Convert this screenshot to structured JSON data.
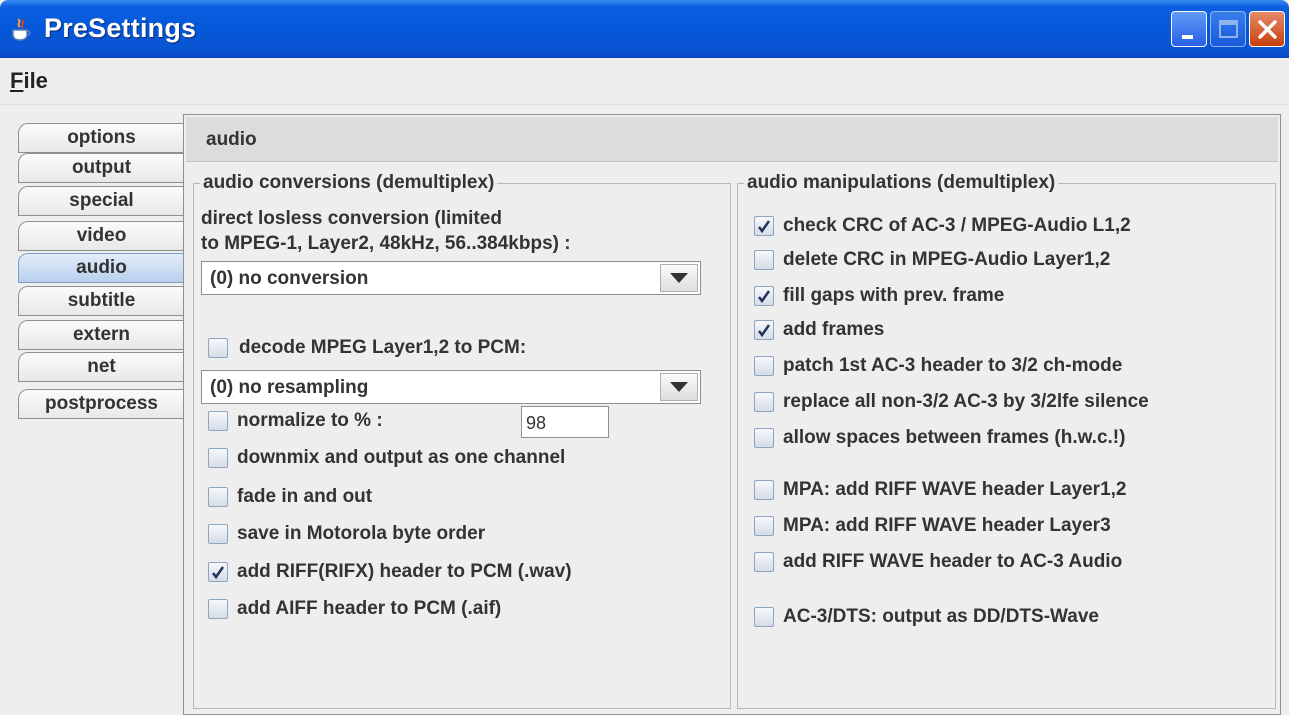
{
  "window": {
    "title": "PreSettings"
  },
  "menu": {
    "file_mnemonic": "F",
    "file_rest": "ile"
  },
  "tabs": [
    {
      "label": "options",
      "active": false
    },
    {
      "label": "output",
      "active": false
    },
    {
      "label": "special",
      "active": false
    },
    {
      "label": "video",
      "active": false
    },
    {
      "label": "audio",
      "active": true
    },
    {
      "label": "subtitle",
      "active": false
    },
    {
      "label": "extern",
      "active": false
    },
    {
      "label": "net",
      "active": false
    },
    {
      "label": "postprocess",
      "active": false
    }
  ],
  "panel": {
    "title": "audio"
  },
  "conversions": {
    "title": "audio conversions (demultiplex)",
    "desc_line1": "direct losless conversion (limited",
    "desc_line2": "to MPEG-1, Layer2, 48kHz, 56..384kbps) :",
    "conversion_combo": "(0) no conversion",
    "decode_label": "decode MPEG Layer1,2 to PCM:",
    "decode_checked": false,
    "resampling_combo": "(0) no resampling",
    "normalize_label": "normalize to % :",
    "normalize_checked": false,
    "normalize_value": "98",
    "options": [
      {
        "label": "downmix and output as one channel",
        "checked": false
      },
      {
        "label": "fade in and out",
        "checked": false
      },
      {
        "label": "save in Motorola byte order",
        "checked": false
      },
      {
        "label": "add RIFF(RIFX) header to PCM (.wav)",
        "checked": true
      },
      {
        "label": "add AIFF header to PCM (.aif)",
        "checked": false
      }
    ]
  },
  "manipulations": {
    "title": "audio manipulations (demultiplex)",
    "options": [
      {
        "label": "check CRC of AC-3 / MPEG-Audio L1,2",
        "checked": true
      },
      {
        "label": "delete CRC in MPEG-Audio Layer1,2",
        "checked": false
      },
      {
        "label": "fill gaps with prev. frame",
        "checked": true
      },
      {
        "label": "add frames",
        "checked": true
      },
      {
        "label": "patch 1st AC-3 header to 3/2 ch-mode",
        "checked": false
      },
      {
        "label": "replace all non-3/2 AC-3 by 3/2lfe silence",
        "checked": false
      },
      {
        "label": "allow spaces between frames (h.w.c.!)",
        "checked": false
      },
      {
        "label": "MPA: add RIFF WAVE header Layer1,2",
        "checked": false
      },
      {
        "label": "MPA: add RIFF WAVE header Layer3",
        "checked": false
      },
      {
        "label": "add RIFF WAVE header to AC-3 Audio",
        "checked": false
      },
      {
        "label": "AC-3/DTS: output as DD/DTS-Wave",
        "checked": false
      }
    ]
  },
  "colors": {
    "titlebar": "#0457d8",
    "active_tab": "#b8cfee",
    "window_bg": "#eeeeee"
  }
}
